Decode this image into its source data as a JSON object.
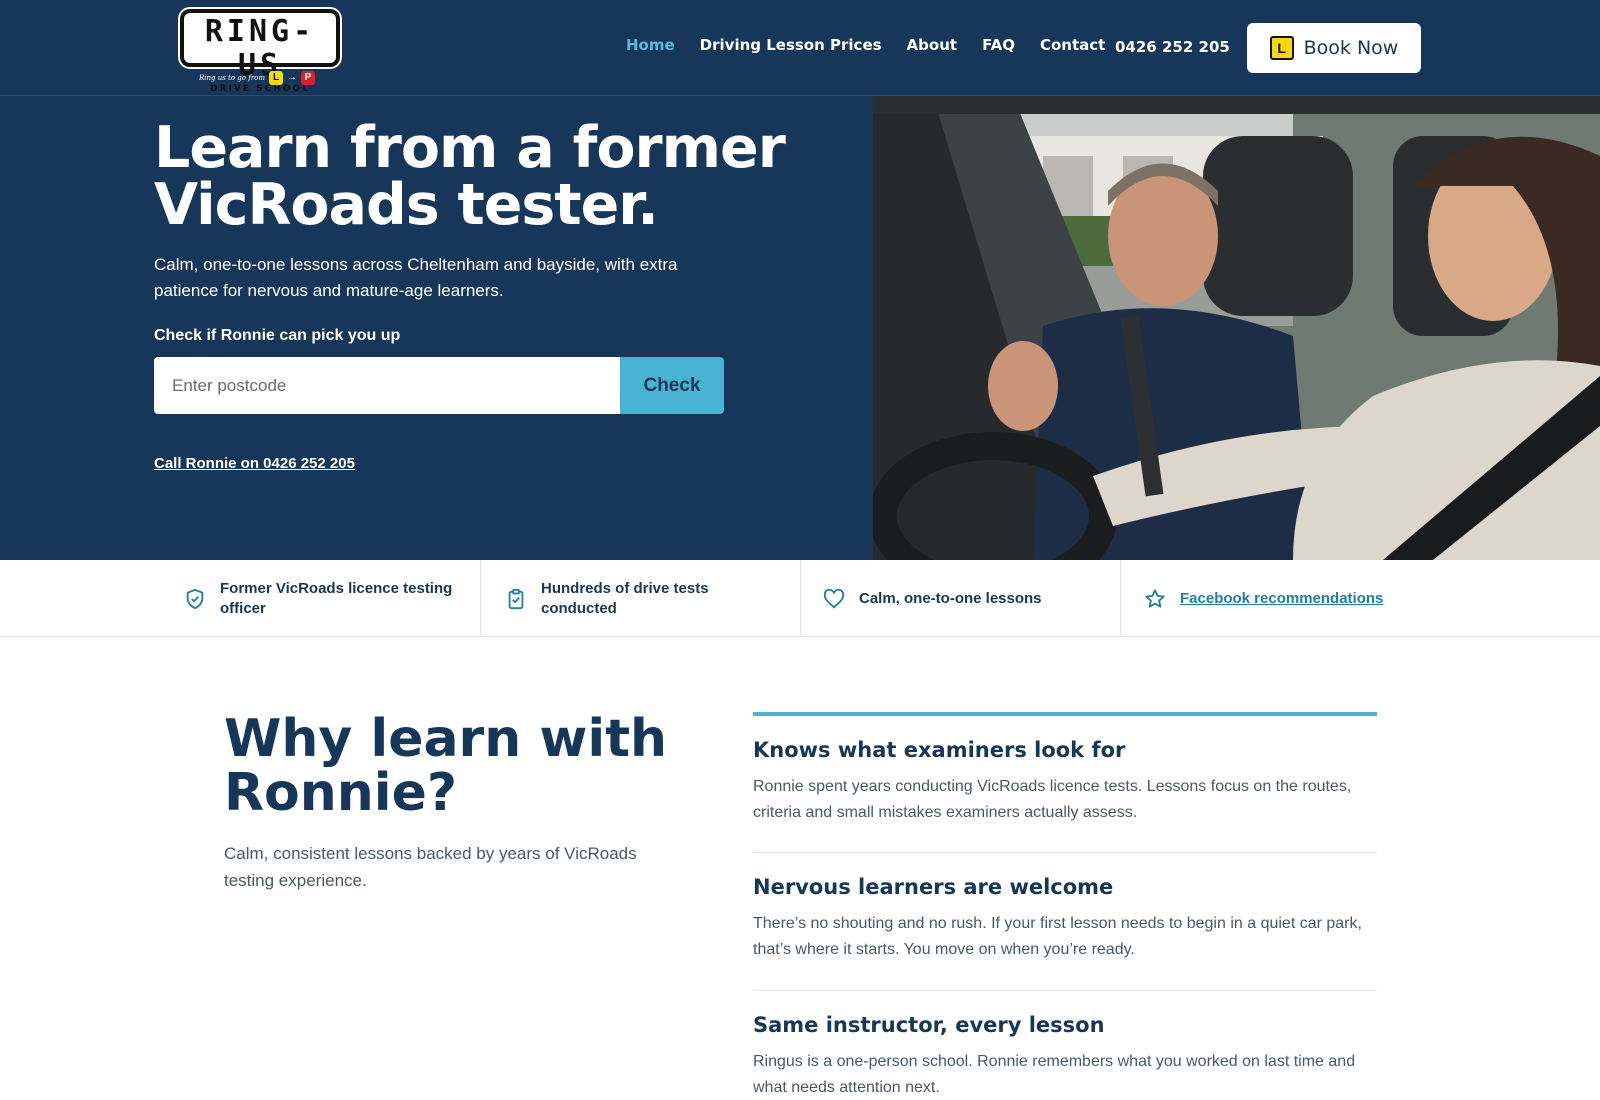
{
  "header": {
    "logo": {
      "name": "RING-US",
      "sub": "DRIVE SCHOOL",
      "tagline": "Ring us to go from",
      "plate_l": "L",
      "plate_p": "P"
    },
    "nav": [
      {
        "label": "Home",
        "active": true
      },
      {
        "label": "Driving Lesson Prices",
        "active": false
      },
      {
        "label": "About",
        "active": false
      },
      {
        "label": "FAQ",
        "active": false
      },
      {
        "label": "Contact",
        "active": false
      }
    ],
    "phone": "0426 252 205",
    "book_icon": "L",
    "book_label": "Book Now"
  },
  "hero": {
    "title_line1": "Learn from a former",
    "title_line2": "VicRoads tester.",
    "subtitle": "Calm, one-to-one lessons across Cheltenham and bayside, with extra patience for nervous and mature-age learners.",
    "check_label": "Check if Ronnie can pick you up",
    "postcode_placeholder": "Enter postcode",
    "check_button": "Check",
    "call_link": "Call Ronnie on 0426 252 205",
    "photo_alt": "driving-instructor-with-learner-photo"
  },
  "trust": [
    {
      "icon": "shield-check-icon",
      "text": "Former VicRoads licence testing officer"
    },
    {
      "icon": "clipboard-check-icon",
      "text": "Hundreds of drive tests conducted"
    },
    {
      "icon": "heart-icon",
      "text": "Calm, one-to-one lessons"
    },
    {
      "icon": "star-icon",
      "text": "Facebook recommendations"
    }
  ],
  "why": {
    "title_line1": "Why learn with",
    "title_line2": "Ronnie?",
    "subtitle": "Calm, consistent lessons backed by years of VicRoads testing experience.",
    "features": [
      {
        "title": "Knows what examiners look for",
        "text": "Ronnie spent years conducting VicRoads licence tests. Lessons focus on the routes, criteria and small mistakes examiners actually assess."
      },
      {
        "title": "Nervous learners are welcome",
        "text": "There’s no shouting and no rush. If your first lesson needs to begin in a quiet car park, that’s where it starts. You move on when you’re ready."
      },
      {
        "title": "Same instructor, every lesson",
        "text": "Ringus is a one-person school. Ronnie remembers what you worked on last time and what needs attention next."
      }
    ]
  },
  "colors": {
    "navy": "#163759",
    "accent": "#4ab3d4",
    "active_nav": "#5bb9dc"
  }
}
